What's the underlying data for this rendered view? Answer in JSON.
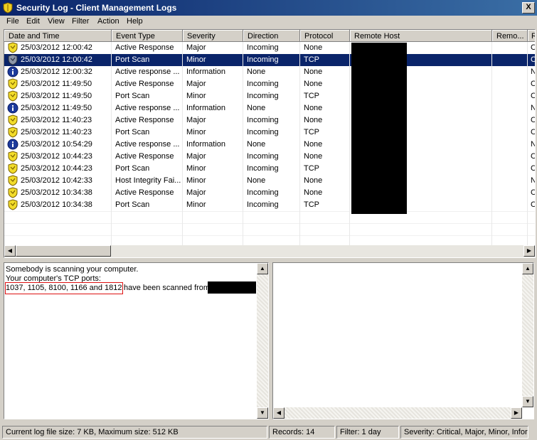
{
  "window": {
    "title": "Security Log - Client Management Logs",
    "close_glyph": "X"
  },
  "menu": [
    {
      "label": "File"
    },
    {
      "label": "Edit"
    },
    {
      "label": "View"
    },
    {
      "label": "Filter"
    },
    {
      "label": "Action"
    },
    {
      "label": "Help"
    }
  ],
  "table": {
    "columns": [
      {
        "label": "Date and Time"
      },
      {
        "label": "Event Type"
      },
      {
        "label": "Severity"
      },
      {
        "label": "Direction"
      },
      {
        "label": "Protocol"
      },
      {
        "label": "Remote Host"
      },
      {
        "label": "Remo..."
      },
      {
        "label": "R"
      }
    ],
    "rows": [
      {
        "icon": "shield-icon",
        "datetime": "25/03/2012 12:00:42",
        "event": "Active Response",
        "severity": "Major",
        "direction": "Incoming",
        "protocol": "None",
        "last": "C",
        "selected": false
      },
      {
        "icon": "shield-icon",
        "datetime": "25/03/2012 12:00:42",
        "event": "Port Scan",
        "severity": "Minor",
        "direction": "Incoming",
        "protocol": "TCP",
        "last": "C",
        "selected": true
      },
      {
        "icon": "info-icon",
        "datetime": "25/03/2012 12:00:32",
        "event": "Active response ...",
        "severity": "Information",
        "direction": "None",
        "protocol": "None",
        "last": "N",
        "selected": false
      },
      {
        "icon": "shield-icon",
        "datetime": "25/03/2012 11:49:50",
        "event": "Active Response",
        "severity": "Major",
        "direction": "Incoming",
        "protocol": "None",
        "last": "C",
        "selected": false
      },
      {
        "icon": "shield-icon",
        "datetime": "25/03/2012 11:49:50",
        "event": "Port Scan",
        "severity": "Minor",
        "direction": "Incoming",
        "protocol": "TCP",
        "last": "C",
        "selected": false
      },
      {
        "icon": "info-icon",
        "datetime": "25/03/2012 11:49:50",
        "event": "Active response ...",
        "severity": "Information",
        "direction": "None",
        "protocol": "None",
        "last": "N",
        "selected": false
      },
      {
        "icon": "shield-icon",
        "datetime": "25/03/2012 11:40:23",
        "event": "Active Response",
        "severity": "Major",
        "direction": "Incoming",
        "protocol": "None",
        "last": "C",
        "selected": false
      },
      {
        "icon": "shield-icon",
        "datetime": "25/03/2012 11:40:23",
        "event": "Port Scan",
        "severity": "Minor",
        "direction": "Incoming",
        "protocol": "TCP",
        "last": "C",
        "selected": false
      },
      {
        "icon": "info-icon",
        "datetime": "25/03/2012 10:54:29",
        "event": "Active response ...",
        "severity": "Information",
        "direction": "None",
        "protocol": "None",
        "last": "N",
        "selected": false
      },
      {
        "icon": "shield-icon",
        "datetime": "25/03/2012 10:44:23",
        "event": "Active Response",
        "severity": "Major",
        "direction": "Incoming",
        "protocol": "None",
        "last": "C",
        "selected": false
      },
      {
        "icon": "shield-icon",
        "datetime": "25/03/2012 10:44:23",
        "event": "Port Scan",
        "severity": "Minor",
        "direction": "Incoming",
        "protocol": "TCP",
        "last": "C",
        "selected": false
      },
      {
        "icon": "shield-icon",
        "datetime": "25/03/2012 10:42:33",
        "event": "Host Integrity Fai...",
        "severity": "Minor",
        "direction": "None",
        "protocol": "None",
        "last": "N",
        "selected": false
      },
      {
        "icon": "shield-icon",
        "datetime": "25/03/2012 10:34:38",
        "event": "Active Response",
        "severity": "Major",
        "direction": "Incoming",
        "protocol": "None",
        "last": "C",
        "selected": false
      },
      {
        "icon": "shield-icon",
        "datetime": "25/03/2012 10:34:38",
        "event": "Port Scan",
        "severity": "Minor",
        "direction": "Incoming",
        "protocol": "TCP",
        "last": "C",
        "selected": false
      }
    ]
  },
  "details": {
    "line1": "Somebody is scanning your computer.",
    "line2": "Your computer's TCP ports:",
    "ports": "1037, 1105, 8100, 1166 and 1812",
    "suffix": "have been scanned from"
  },
  "status": {
    "log_size": "Current log file size: 7 KB, Maximum size: 512 KB",
    "records": "Records: 14",
    "filter": "Filter: 1 day",
    "severity": "Severity: Critical, Major, Minor, Infor"
  },
  "colors": {
    "selection": "#0a246a",
    "title_start": "#0a246a",
    "title_end": "#3a6ea5",
    "highlight_box": "#dd1111"
  }
}
